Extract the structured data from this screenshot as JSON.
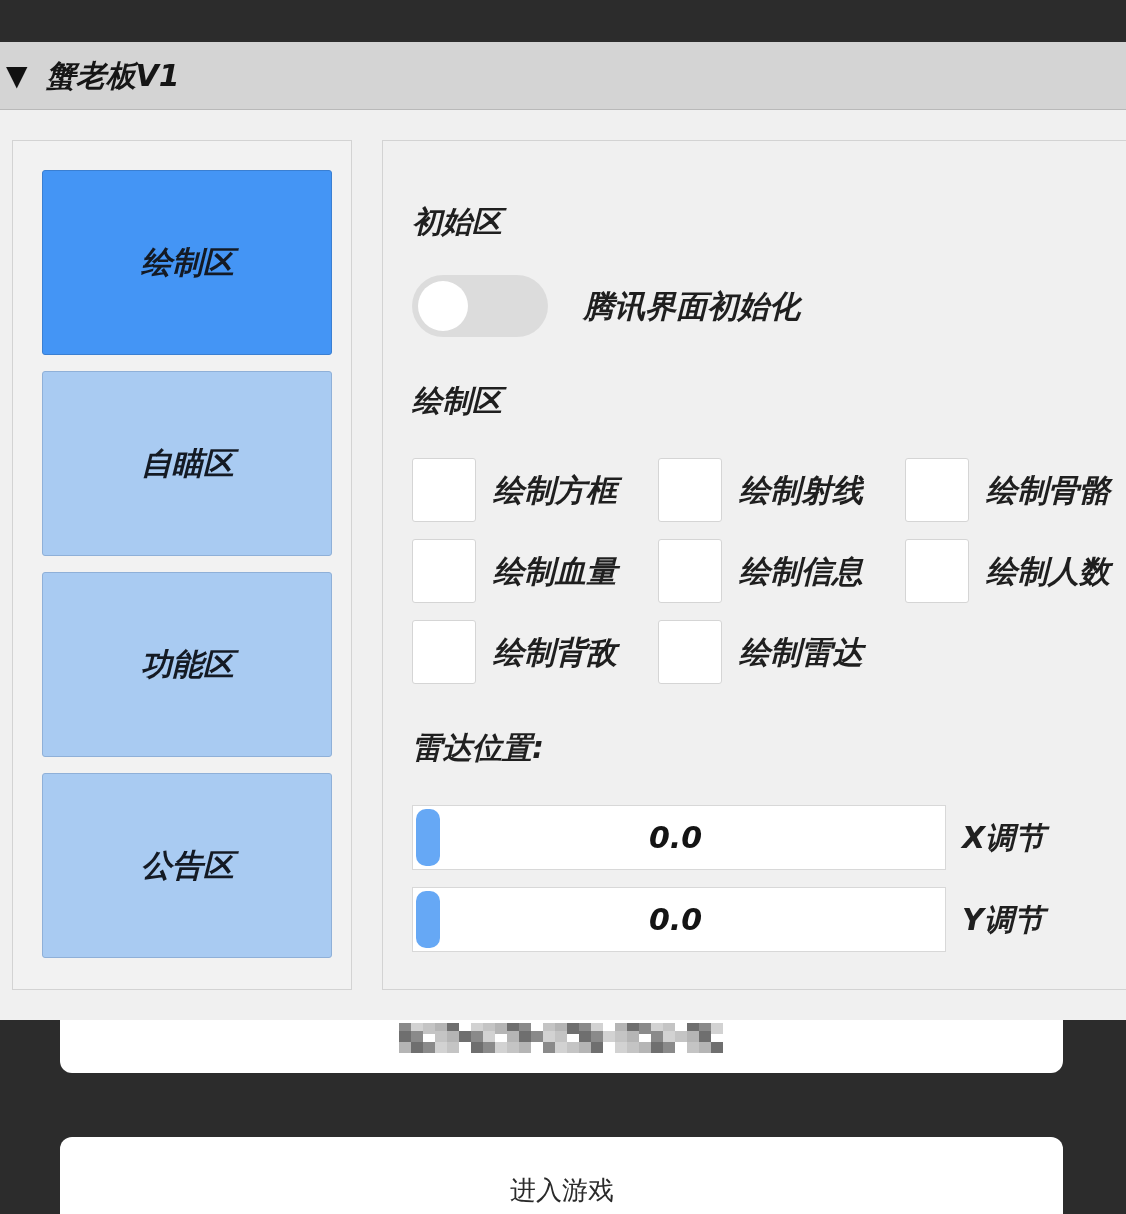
{
  "window": {
    "toggle_glyph": "▼",
    "title": "蟹老板V1"
  },
  "sidebar": {
    "tabs": [
      {
        "label": "绘制区",
        "selected": true
      },
      {
        "label": "自瞄区",
        "selected": false
      },
      {
        "label": "功能区",
        "selected": false
      },
      {
        "label": "公告区",
        "selected": false
      }
    ]
  },
  "content": {
    "sections": [
      {
        "kind": "heading",
        "text": "初始区"
      },
      {
        "kind": "switch",
        "label": "腾讯界面初始化",
        "on": false
      },
      {
        "kind": "heading",
        "text": "绘制区"
      },
      {
        "kind": "checkboxes",
        "items": [
          {
            "label": "绘制方框",
            "checked": false
          },
          {
            "label": "绘制射线",
            "checked": false
          },
          {
            "label": "绘制骨骼",
            "checked": false
          },
          {
            "label": "绘制血量",
            "checked": false
          },
          {
            "label": "绘制信息",
            "checked": false
          },
          {
            "label": "绘制人数",
            "checked": false
          },
          {
            "label": "绘制背敌",
            "checked": false
          },
          {
            "label": "绘制雷达",
            "checked": false
          }
        ]
      },
      {
        "kind": "heading",
        "text": "雷达位置:"
      },
      {
        "kind": "slider",
        "value": "0.0",
        "label": "X调节",
        "level": 0
      },
      {
        "kind": "slider",
        "value": "0.0",
        "label": "Y调节",
        "level": 0
      }
    ]
  },
  "enter_button": {
    "label": "进入游戏"
  }
}
